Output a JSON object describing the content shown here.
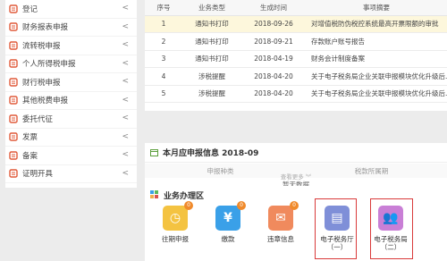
{
  "sidebar": {
    "items": [
      {
        "label": "登记",
        "icon": "register-icon",
        "color": "#e05a3a"
      },
      {
        "label": "财务报表申报",
        "icon": "report-icon",
        "color": "#e05a3a"
      },
      {
        "label": "流转税申报",
        "icon": "turnover-icon",
        "color": "#e05a3a"
      },
      {
        "label": "个人所得税申报",
        "icon": "person-icon",
        "color": "#e05a3a"
      },
      {
        "label": "财行税申报",
        "icon": "property-icon",
        "color": "#e05a3a"
      },
      {
        "label": "其他税费申报",
        "icon": "other-tax-icon",
        "color": "#e05a3a"
      },
      {
        "label": "委托代征",
        "icon": "delegate-icon",
        "color": "#e05a3a"
      },
      {
        "label": "发票",
        "icon": "invoice-icon",
        "color": "#e05a3a"
      },
      {
        "label": "备案",
        "icon": "filing-icon",
        "color": "#e05a3a"
      },
      {
        "label": "证明开具",
        "icon": "certificate-icon",
        "color": "#e05a3a"
      }
    ],
    "chevron": "<"
  },
  "messages": {
    "headers": [
      "序号",
      "业务类型",
      "生成时间",
      "事项摘要"
    ],
    "rows": [
      {
        "no": "1",
        "type": "通知书打印",
        "date": "2018-09-26",
        "summary": "对增值税防伪税控系统最高开票限额的审批",
        "highlight": true
      },
      {
        "no": "2",
        "type": "通知书打印",
        "date": "2018-09-21",
        "summary": "存款账户账号报告",
        "highlight": false
      },
      {
        "no": "3",
        "type": "通知书打印",
        "date": "2018-04-19",
        "summary": "财务会计制度备案",
        "highlight": false
      },
      {
        "no": "4",
        "type": "涉税提醒",
        "date": "2018-04-20",
        "summary": "关于电子税务局企业关联申报模块优化升级后...",
        "highlight": false
      },
      {
        "no": "5",
        "type": "涉税提醒",
        "date": "2018-04-20",
        "summary": "关于电子税务局企业关联申报模块优化升级后...",
        "highlight": false
      }
    ]
  },
  "monthly": {
    "title": "本月应申报信息  2018-09",
    "col1": "申报种类",
    "col2": "税款所属期",
    "empty": "暂无数据",
    "more": "查看更多 ︾"
  },
  "business": {
    "title": "业务办理区",
    "tiles": [
      {
        "label": "往期申报",
        "sub": "",
        "badge": "0",
        "color": "#f4c341",
        "glyph": "◷",
        "icon": "clock-icon"
      },
      {
        "label": "缴款",
        "sub": "",
        "badge": "0",
        "color": "#3aa0e8",
        "glyph": "¥",
        "icon": "yen-icon"
      },
      {
        "label": "违章信息",
        "sub": "",
        "badge": "0",
        "color": "#f08a5d",
        "glyph": "✉",
        "icon": "mail-icon"
      },
      {
        "label": "电子税务厅",
        "sub": "（一）",
        "badge": "",
        "color": "#7f8fd8",
        "glyph": "▤",
        "icon": "document-icon"
      },
      {
        "label": "电子税务局",
        "sub": "（二）",
        "badge": "",
        "color": "#c97fd6",
        "glyph": "👥",
        "icon": "people-icon"
      }
    ]
  }
}
